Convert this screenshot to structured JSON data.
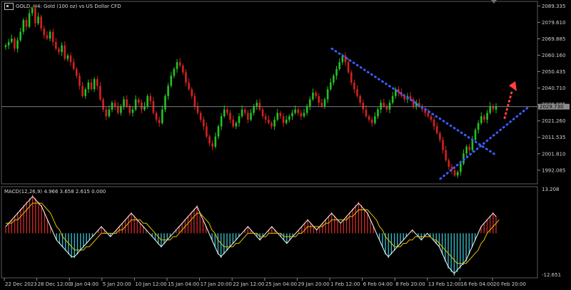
{
  "header": {
    "title": "GOLD, H4:  Gold (100 oz) vs US Dollar CFD",
    "symbol_icon": "chart-window-icon"
  },
  "macd_header": {
    "label": "MACD(12,26,9) 4.966 3.658 2.615 0.000"
  },
  "colors": {
    "background": "#000000",
    "bull_candle": "#22c322",
    "bear_candle": "#d42121",
    "macd_positive": "#c62828",
    "macd_negative": "#35b7c4",
    "macd_line": "#ffffff",
    "signal_line": "#e6c400",
    "trendline": "#3a5cff",
    "arrow": "#ff4040",
    "current_price_line": "#8c8c8c"
  },
  "chart_data": [
    {
      "type": "candlestick",
      "panel": "price",
      "title": "GOLD, H4:  Gold (100 oz) vs US Dollar CFD",
      "ylim": [
        1984.0,
        2092.0
      ],
      "y_ticks": [
        "2089.335",
        "2079.610",
        "2069.885",
        "2060.160",
        "2050.435",
        "2040.710",
        "2030.985",
        "2021.260",
        "2011.535",
        "2001.810",
        "1992.085"
      ],
      "y_tick_values": [
        2089.335,
        2079.61,
        2069.885,
        2060.16,
        2050.435,
        2040.71,
        2030.985,
        2021.26,
        2011.535,
        2001.81,
        1992.085
      ],
      "current_price": 2029.7,
      "current_price_label": "2029.730",
      "x_ticks": [
        "22 Dec 2023",
        "28 Dec 12:00",
        "3 Jan 04:00",
        "5 Jan 20:00",
        "10 Jan 12:00",
        "15 Jan 04:00",
        "17 Jan 20:00",
        "22 Jan 12:00",
        "25 Jan 04:00",
        "29 Jan 20:00",
        "1 Feb 12:00",
        "6 Feb 04:00",
        "8 Feb 20:00",
        "13 Feb 12:00",
        "16 Feb 04:00",
        "20 Feb 20:00"
      ],
      "closes": [
        2066,
        2068,
        2070,
        2064,
        2069,
        2074,
        2081,
        2077,
        2085,
        2088,
        2079,
        2083,
        2076,
        2072,
        2070,
        2074,
        2068,
        2064,
        2062,
        2066,
        2058,
        2060,
        2056,
        2052,
        2048,
        2042,
        2036,
        2040,
        2044,
        2040,
        2046,
        2042,
        2034,
        2028,
        2024,
        2028,
        2032,
        2030,
        2026,
        2030,
        2034,
        2030,
        2026,
        2028,
        2034,
        2032,
        2028,
        2030,
        2036,
        2033,
        2026,
        2022,
        2020,
        2028,
        2036,
        2042,
        2048,
        2052,
        2056,
        2054,
        2050,
        2044,
        2040,
        2036,
        2030,
        2026,
        2022,
        2018,
        2012,
        2008,
        2006,
        2012,
        2018,
        2024,
        2028,
        2026,
        2022,
        2018,
        2020,
        2024,
        2028,
        2026,
        2022,
        2026,
        2030,
        2032,
        2028,
        2024,
        2022,
        2020,
        2018,
        2022,
        2026,
        2024,
        2020,
        2022,
        2024,
        2026,
        2028,
        2026,
        2024,
        2026,
        2030,
        2034,
        2038,
        2036,
        2032,
        2030,
        2034,
        2040,
        2044,
        2048,
        2052,
        2056,
        2060,
        2056,
        2050,
        2044,
        2040,
        2036,
        2032,
        2028,
        2024,
        2022,
        2020,
        2024,
        2028,
        2032,
        2030,
        2028,
        2032,
        2036,
        2040,
        2038,
        2036,
        2034,
        2036,
        2034,
        2030,
        2032,
        2030,
        2028,
        2026,
        2024,
        2022,
        2018,
        2014,
        2010,
        2004,
        1998,
        1994,
        1992,
        1989,
        1991,
        1996,
        2002,
        2006,
        2004,
        2010,
        2016,
        2020,
        2024,
        2022,
        2026,
        2030,
        2028,
        2030
      ]
    },
    {
      "type": "bar+line",
      "panel": "indicator",
      "title": "MACD(12,26,9) 4.966 3.658 2.615 0.000",
      "ylim": [
        -12.651,
        13.208
      ],
      "y_ticks": [
        "13.208",
        "-12.651"
      ],
      "y_tick_values": [
        13.208,
        -12.651
      ],
      "series": [
        {
          "name": "MACD",
          "values": [
            2,
            3,
            4,
            5,
            6,
            7,
            8,
            9,
            10,
            11,
            10,
            9,
            8,
            6,
            4,
            2,
            0,
            -2,
            -3,
            -4,
            -5,
            -6,
            -7,
            -7,
            -6,
            -5,
            -4,
            -3,
            -2,
            -1,
            0,
            1,
            2,
            1,
            0,
            -1,
            0,
            1,
            2,
            3,
            4,
            5,
            6,
            5,
            4,
            3,
            2,
            1,
            0,
            -1,
            -2,
            -3,
            -4,
            -3,
            -2,
            -1,
            0,
            1,
            2,
            3,
            4,
            5,
            6,
            7,
            8,
            6,
            4,
            2,
            0,
            -2,
            -4,
            -6,
            -7,
            -6,
            -5,
            -4,
            -3,
            -2,
            -1,
            0,
            1,
            2,
            1,
            0,
            -1,
            -2,
            -1,
            0,
            1,
            2,
            1,
            0,
            -1,
            -2,
            -3,
            -2,
            -1,
            0,
            1,
            2,
            3,
            4,
            3,
            2,
            1,
            2,
            3,
            4,
            5,
            6,
            5,
            4,
            3,
            4,
            5,
            6,
            7,
            8,
            9,
            8,
            7,
            6,
            4,
            2,
            0,
            -2,
            -4,
            -6,
            -7,
            -6,
            -5,
            -4,
            -3,
            -2,
            -1,
            0,
            1,
            0,
            -1,
            -2,
            -1,
            0,
            -1,
            -2,
            -3,
            -4,
            -6,
            -8,
            -10,
            -11,
            -12,
            -11,
            -10,
            -9,
            -8,
            -6,
            -4,
            -2,
            0,
            2,
            3,
            4,
            5,
            6,
            5
          ]
        },
        {
          "name": "Signal",
          "values": [
            3,
            3,
            3,
            4,
            4,
            5,
            6,
            7,
            8,
            9,
            9,
            9,
            9,
            8,
            7,
            6,
            4,
            2,
            1,
            -1,
            -2,
            -3,
            -4,
            -5,
            -5,
            -5,
            -5,
            -4,
            -4,
            -3,
            -2,
            -1,
            0,
            0,
            0,
            0,
            0,
            0,
            1,
            1,
            2,
            3,
            4,
            4,
            4,
            4,
            3,
            3,
            2,
            1,
            0,
            -1,
            -2,
            -2,
            -2,
            -2,
            -1,
            -1,
            0,
            1,
            2,
            3,
            4,
            5,
            6,
            6,
            5,
            4,
            3,
            1,
            0,
            -2,
            -3,
            -4,
            -4,
            -4,
            -4,
            -3,
            -3,
            -2,
            -1,
            0,
            0,
            0,
            0,
            -1,
            -1,
            -1,
            0,
            0,
            0,
            0,
            0,
            -1,
            -1,
            -1,
            -1,
            -1,
            0,
            0,
            1,
            2,
            2,
            2,
            2,
            2,
            2,
            3,
            3,
            4,
            4,
            4,
            4,
            4,
            4,
            5,
            5,
            6,
            7,
            7,
            7,
            7,
            6,
            5,
            4,
            2,
            1,
            -1,
            -2,
            -3,
            -4,
            -4,
            -4,
            -3,
            -3,
            -2,
            -2,
            -1,
            -1,
            -1,
            -1,
            -1,
            -1,
            -2,
            -2,
            -3,
            -4,
            -5,
            -6,
            -7,
            -8,
            -9,
            -9,
            -9,
            -9,
            -8,
            -7,
            -6,
            -5,
            -3,
            -2,
            0,
            1,
            2,
            3,
            4
          ]
        }
      ]
    }
  ]
}
